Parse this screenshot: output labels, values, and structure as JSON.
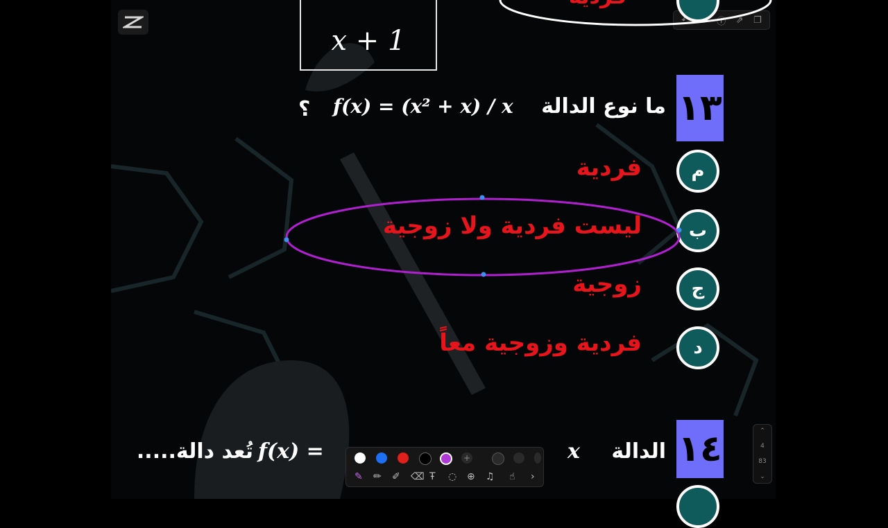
{
  "app": {
    "logo_icon": "capcut-logo-icon"
  },
  "toolbar_top": {
    "undo": "↶",
    "redo": "↷",
    "info": "ⓘ",
    "export": "⇗",
    "copy": "❐"
  },
  "board": {
    "boxed_expression": "x + 1",
    "prev_option_text": "فردية",
    "q13": {
      "number": "١٣",
      "prefix": "ما نوع الدالة",
      "formula": "f(x) = (x² + x) / x",
      "suffix": "؟"
    },
    "options": [
      {
        "letter": "م",
        "text": "فردية"
      },
      {
        "letter": "ب",
        "text": "ليست فردية ولا زوجية"
      },
      {
        "letter": "ج",
        "text": "زوجية"
      },
      {
        "letter": "د",
        "text": "فردية وزوجية معاً"
      }
    ],
    "q14": {
      "number": "١٤",
      "prefix": "الدالة",
      "formula_a": "x",
      "formula_b": "f(x) =",
      "suffix": "تُعد دالة....."
    }
  },
  "pen_toolbar": {
    "colors": [
      "#ffffff",
      "#1f6ff2",
      "#e0201c",
      "#000000",
      "#b03ad6"
    ],
    "selected_color": "#b03ad6",
    "tools": [
      "pen-icon",
      "pencil-icon",
      "highlighter-icon",
      "eraser-icon",
      "text-icon",
      "lasso-icon",
      "add-icon",
      "mic-icon",
      "gesture-icon",
      "chevron-right-icon"
    ],
    "add": "+",
    "chevron": "›"
  },
  "pager": {
    "current": "4",
    "total": "83",
    "up": "⌃",
    "down": "⌄"
  },
  "colors": {
    "badge": "#6e6efa",
    "option_red": "#e8141b",
    "option_circle": "#0f5a5a",
    "ellipse_purple": "#b020d0"
  }
}
